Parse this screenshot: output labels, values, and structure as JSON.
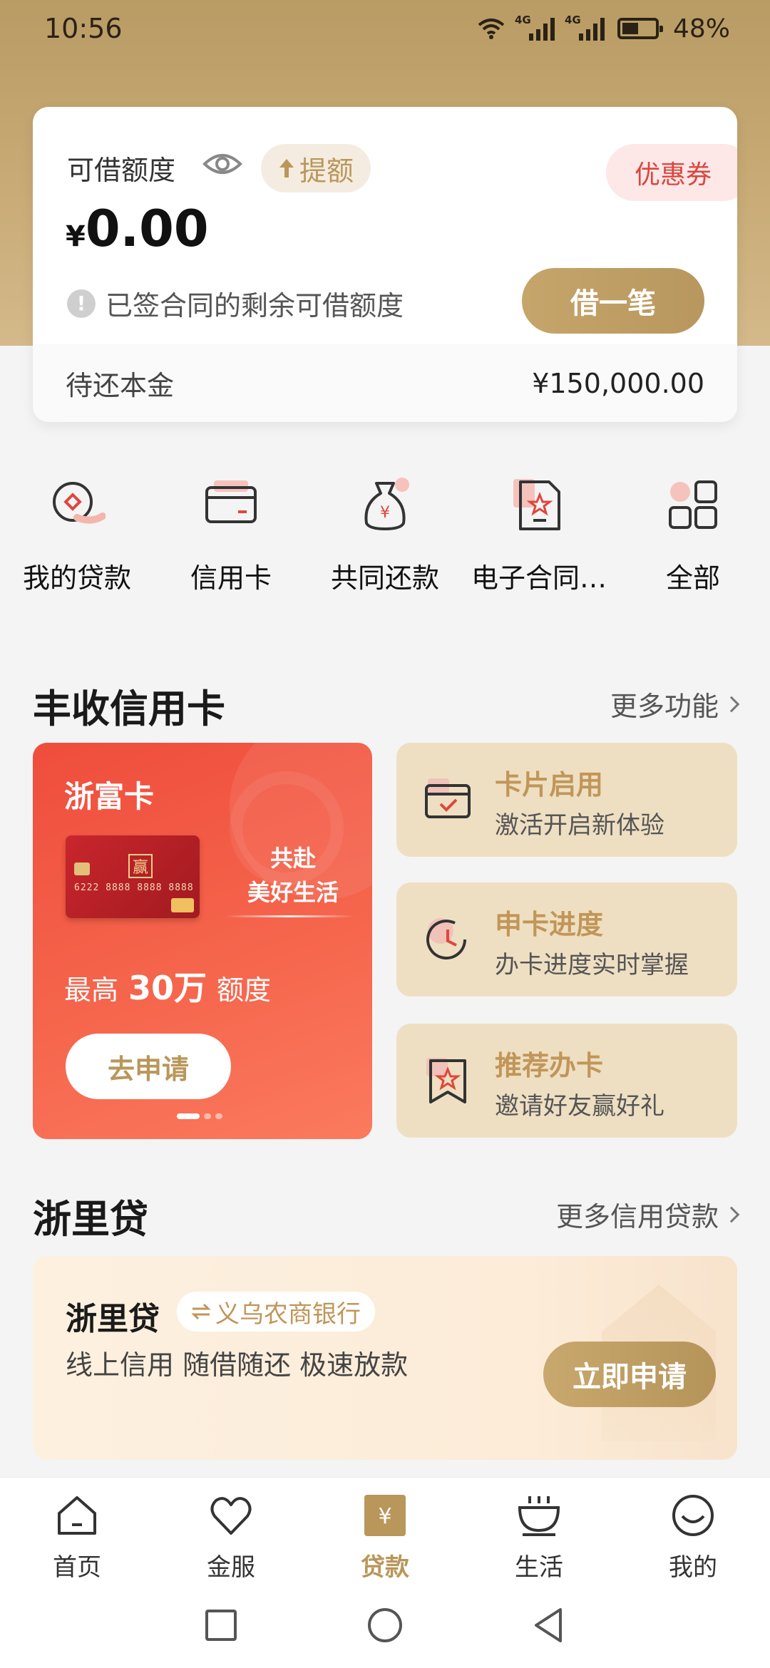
{
  "status": {
    "time": "10:56",
    "network1": "4G",
    "network2": "4G",
    "battery": "48%"
  },
  "quota": {
    "label": "可借额度",
    "raise_label": "提额",
    "coupon_label": "优惠券",
    "currency": "¥",
    "amount": "0.00",
    "note": "已签合同的剩余可借额度",
    "borrow_label": "借一笔",
    "principal_label": "待还本金",
    "principal_value": "¥150,000.00"
  },
  "quick": [
    {
      "label": "我的贷款",
      "icon": "my-loan-icon"
    },
    {
      "label": "信用卡",
      "icon": "credit-card-icon"
    },
    {
      "label": "共同还款",
      "icon": "money-bag-icon"
    },
    {
      "label": "电子合同…",
      "icon": "e-contract-icon"
    },
    {
      "label": "全部",
      "icon": "grid-icon"
    }
  ],
  "credit_section": {
    "title": "丰收信用卡",
    "more": "更多功能"
  },
  "promo": {
    "title": "浙富卡",
    "slogan_line1": "共赴",
    "slogan_line2": "美好生活",
    "limit_prefix": "最高",
    "limit_value": "30万",
    "limit_suffix": "额度",
    "apply_label": "去申请",
    "card_logo": "赢",
    "card_number": "6222 8888 8888 8888"
  },
  "features": [
    {
      "title": "卡片启用",
      "subtitle": "激活开启新体验",
      "icon": "card-activate-icon"
    },
    {
      "title": "申卡进度",
      "subtitle": "办卡进度实时掌握",
      "icon": "clock-progress-icon"
    },
    {
      "title": "推荐办卡",
      "subtitle": "邀请好友赢好礼",
      "icon": "bookmark-star-icon"
    }
  ],
  "loan_section": {
    "title": "浙里贷",
    "more": "更多信用贷款"
  },
  "loan": {
    "title": "浙里贷",
    "bank": "义乌农商银行",
    "desc": "线上信用 随借随还 极速放款",
    "apply_label": "立即申请"
  },
  "tabs": [
    {
      "label": "首页",
      "icon": "home-icon"
    },
    {
      "label": "金服",
      "icon": "heart-icon"
    },
    {
      "label": "贷款",
      "icon": "loan-yen-icon",
      "active": true
    },
    {
      "label": "生活",
      "icon": "cup-icon"
    },
    {
      "label": "我的",
      "icon": "smile-icon"
    }
  ],
  "colors": {
    "gold": "#b9965a",
    "red": "#ef4d3c",
    "feature_bg": "#efdfc2"
  }
}
